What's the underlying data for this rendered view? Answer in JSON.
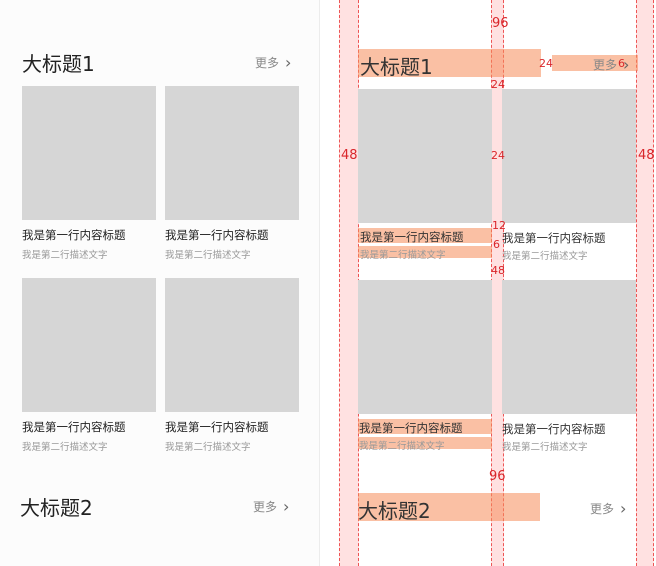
{
  "mockup": {
    "section1": {
      "title": "大标题1",
      "more": "更多"
    },
    "section2": {
      "title": "大标题2",
      "more": "更多"
    },
    "cards": [
      {
        "title": "我是第一行内容标题",
        "desc": "我是第二行描述文字"
      },
      {
        "title": "我是第一行内容标题",
        "desc": "我是第二行描述文字"
      },
      {
        "title": "我是第一行内容标题",
        "desc": "我是第二行描述文字"
      },
      {
        "title": "我是第一行内容标题",
        "desc": "我是第二行描述文字"
      }
    ]
  },
  "spec": {
    "section1": {
      "title": "大标题1",
      "more": "更多"
    },
    "section2": {
      "title": "大标题2",
      "more": "更多"
    },
    "cards": [
      {
        "title": "我是第一行内容标题",
        "desc": "我是第二行描述文字"
      },
      {
        "title": "我是第一行内容标题",
        "desc": "我是第二行描述文字"
      },
      {
        "title": "我是第一行内容标题",
        "desc": "我是第二行描述文字"
      },
      {
        "title": "我是第一行内容标题",
        "desc": "我是第二行描述文字"
      }
    ],
    "measurements": {
      "top_gap": "96",
      "title_gap": "24",
      "more_gap": "6",
      "title_to_image": "24",
      "left_margin": "48",
      "right_margin": "48",
      "column_gap": "24",
      "image_to_text": "12",
      "line_gap": "6",
      "row_gap": "48",
      "section_gap": "96"
    }
  }
}
